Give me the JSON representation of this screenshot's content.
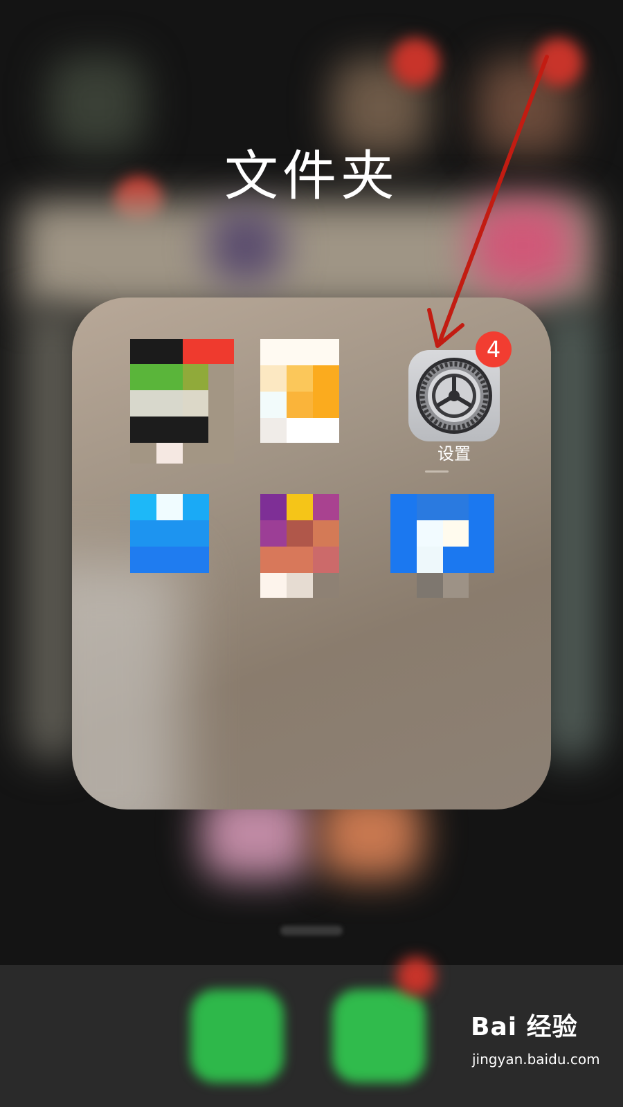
{
  "folder": {
    "title": "文件夹"
  },
  "apps": [
    {
      "name": "app-1",
      "label": ""
    },
    {
      "name": "app-2",
      "label": ""
    },
    {
      "name": "settings",
      "label": "设置",
      "badge": "4",
      "icon": "gear-icon"
    },
    {
      "name": "app-4",
      "label": ""
    },
    {
      "name": "app-5",
      "label": ""
    },
    {
      "name": "app-6",
      "label": ""
    }
  ],
  "dock": {
    "apps": [
      "phone-icon",
      "messages-icon"
    ]
  },
  "watermark": {
    "logo": "Bai 经验",
    "url": "jingyan.baidu.com"
  },
  "colors": {
    "badge": "#f23d31",
    "arrow": "#c21c12",
    "title_text": "#ffffff"
  }
}
